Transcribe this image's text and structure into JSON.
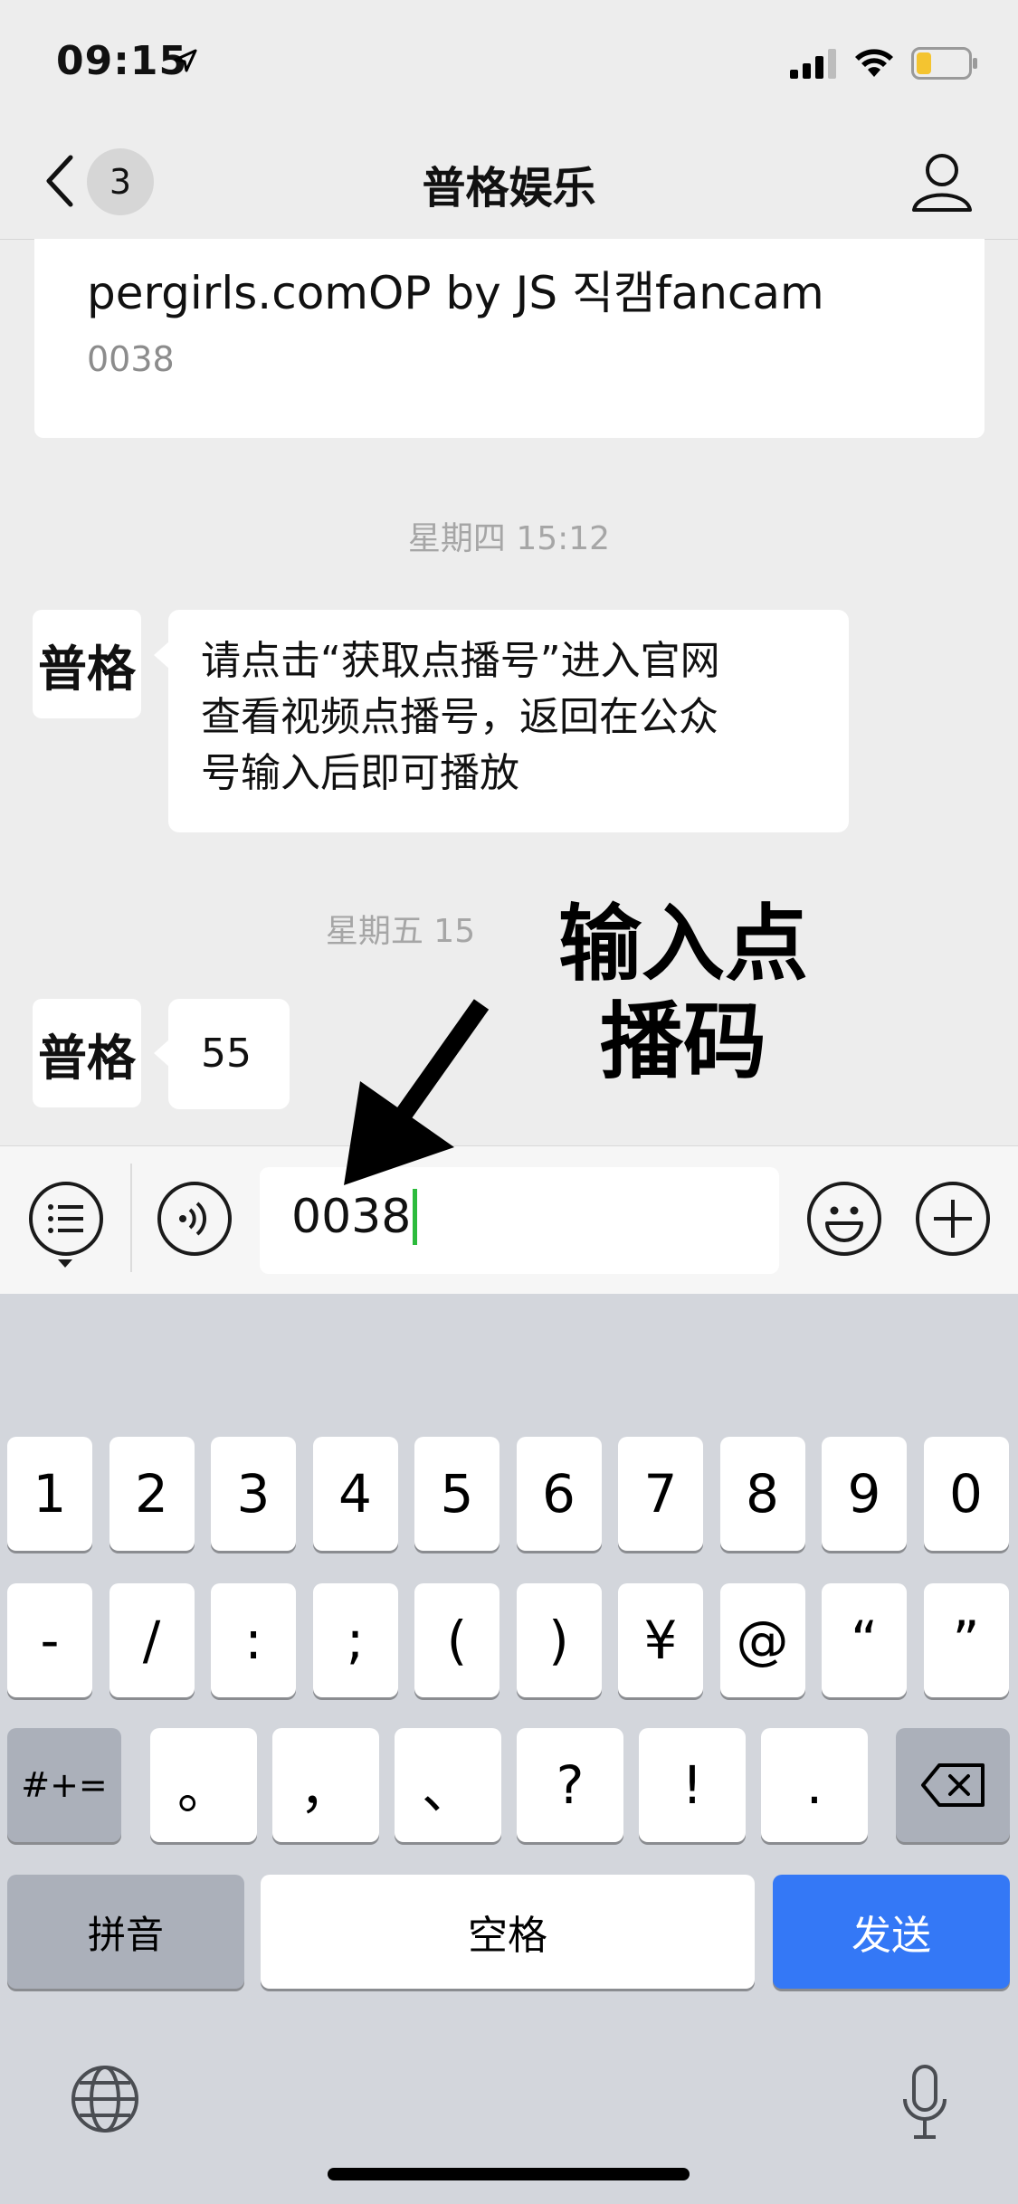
{
  "status_bar": {
    "time": "09:15",
    "icons": [
      "location-arrow-icon",
      "signal-icon",
      "wifi-icon",
      "battery-icon"
    ]
  },
  "nav": {
    "back_badge": "3",
    "title": "普格娱乐",
    "icons": [
      "back-chevron-icon",
      "profile-icon"
    ]
  },
  "chat": {
    "card": {
      "title": "pergirls.comOP by JS 직캠fancam",
      "subtitle": "0038"
    },
    "timestamp_1": "星期四 15:12",
    "avatar_text": "普格",
    "message_1": [
      "请点击“获取点播号”进入官网",
      "查看视频点播号，返回在公众",
      "号输入后即可播放"
    ],
    "timestamp_2": "星期五 15",
    "message_2": "55"
  },
  "annotation": {
    "line1": "输入点",
    "line2": "播码"
  },
  "input_bar": {
    "value": "0038",
    "icons": [
      "menu-list-icon",
      "voice-icon",
      "emoji-icon",
      "plus-icon"
    ]
  },
  "keyboard": {
    "row1": [
      "1",
      "2",
      "3",
      "4",
      "5",
      "6",
      "7",
      "8",
      "9",
      "0"
    ],
    "row2": [
      "-",
      "/",
      ":",
      ";",
      "(",
      ")",
      "¥",
      "@",
      "“",
      "”"
    ],
    "row3_mode": "#+=",
    "row3": [
      "。",
      "，",
      "、",
      "?",
      "!",
      "."
    ],
    "pinyin": "拼音",
    "space": "空格",
    "send": "发送",
    "icons": [
      "backspace-icon",
      "globe-icon",
      "microphone-icon"
    ]
  },
  "colors": {
    "accent": "#3478f6",
    "caret": "#2cbb3c",
    "background": "#ededed"
  }
}
